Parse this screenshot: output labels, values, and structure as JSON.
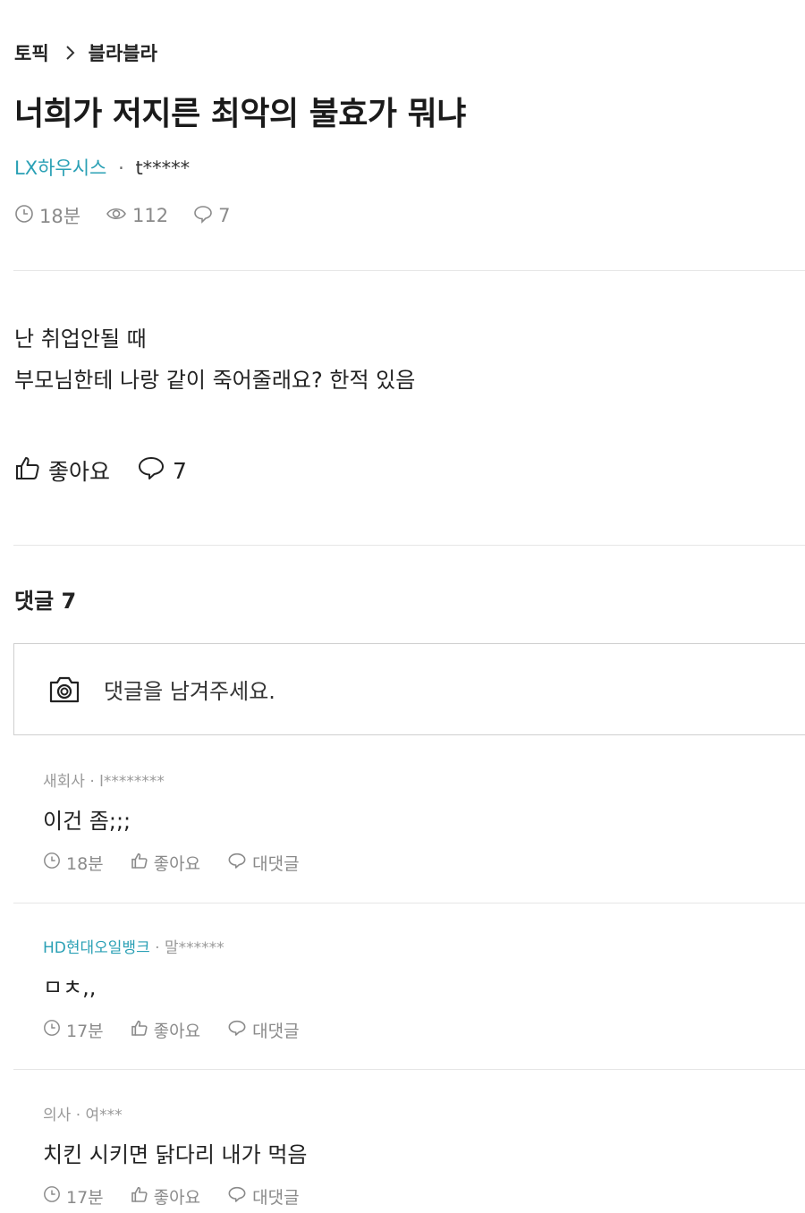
{
  "breadcrumb": {
    "section": "토픽",
    "topic": "블라블라"
  },
  "post": {
    "title": "너희가 저지른 최악의 불효가 뭐냐",
    "company": "LX하우시스",
    "separator": "·",
    "user": "t*****",
    "time": "18분",
    "views": "112",
    "comment_count": "7",
    "body": [
      "난 취업안될 때",
      "부모님한테 나랑 같이 죽어줄래요? 한적 있음"
    ],
    "like_label": "좋아요",
    "comment_action_count": "7"
  },
  "comments_section": {
    "heading": "댓글 7",
    "placeholder": "댓글을 남겨주세요."
  },
  "comments": [
    {
      "company": "새회사",
      "separator": "·",
      "user": "l********",
      "text": "이건 좀;;;",
      "time": "18분",
      "like_label": "좋아요",
      "reply_label": "대댓글",
      "company_highlight": false
    },
    {
      "company": "HD현대오일뱅크",
      "separator": "·",
      "user": "말******",
      "text": "ㅁㅊ,,",
      "time": "17분",
      "like_label": "좋아요",
      "reply_label": "대댓글",
      "company_highlight": true
    },
    {
      "company": "의사",
      "separator": "·",
      "user": "여***",
      "text": "치킨 시키면 닭다리 내가 먹음",
      "time": "17분",
      "like_label": "좋아요",
      "reply_label": "대댓글",
      "company_highlight": false
    }
  ],
  "icons": {
    "chevron": "chevron-right-icon",
    "clock": "clock-icon",
    "eye": "eye-icon",
    "speech": "speech-bubble-icon",
    "thumb": "thumbs-up-icon",
    "camera": "camera-icon"
  },
  "colors": {
    "accent": "#2aa0b5",
    "muted": "#8a8a8a",
    "text": "#222222",
    "divider": "#e6e6e6"
  }
}
